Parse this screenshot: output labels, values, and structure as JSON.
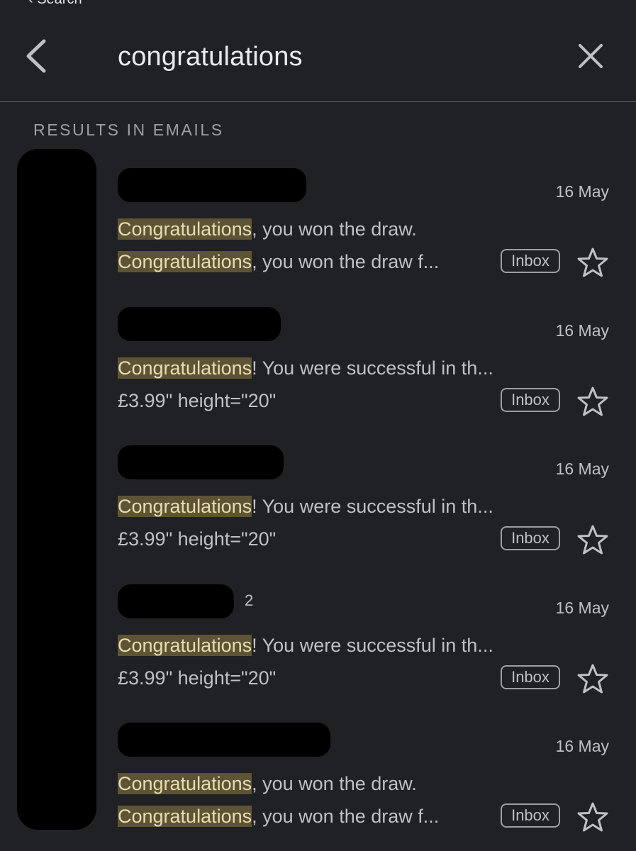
{
  "status_bar": {
    "back_app_label": "‹ Search"
  },
  "header": {
    "query": "congratulations",
    "back_icon": "chevron-left-icon",
    "close_icon": "close-icon"
  },
  "section": {
    "title": "RESULTS IN EMAILS"
  },
  "results": [
    {
      "date": "16 May",
      "sender_count": "",
      "subject_highlight": "Congratulations",
      "subject_rest": ", you won the draw.",
      "snippet_highlight": "Congratulations",
      "snippet_rest": ", you won the draw f...",
      "label": "Inbox"
    },
    {
      "date": "16 May",
      "sender_count": "",
      "subject_highlight": "Congratulations",
      "subject_rest": "! You were successful in th...",
      "snippet_highlight": "",
      "snippet_rest": "£3.99\" height=\"20\"",
      "label": "Inbox"
    },
    {
      "date": "16 May",
      "sender_count": "",
      "subject_highlight": "Congratulations",
      "subject_rest": "! You were successful in th...",
      "snippet_highlight": "",
      "snippet_rest": "£3.99\" height=\"20\"",
      "label": "Inbox"
    },
    {
      "date": "16 May",
      "sender_count": "2",
      "subject_highlight": "Congratulations",
      "subject_rest": "! You were successful in th...",
      "snippet_highlight": "",
      "snippet_rest": "£3.99\" height=\"20\"",
      "label": "Inbox"
    },
    {
      "date": "16 May",
      "sender_count": "",
      "subject_highlight": "Congratulations",
      "subject_rest": ", you won the draw.",
      "snippet_highlight": "Congratulations",
      "snippet_rest": ", you won the draw f...",
      "label": "Inbox"
    }
  ],
  "colors": {
    "background": "#202124",
    "highlight": "#5c5435",
    "text": "#bdc1c6"
  }
}
